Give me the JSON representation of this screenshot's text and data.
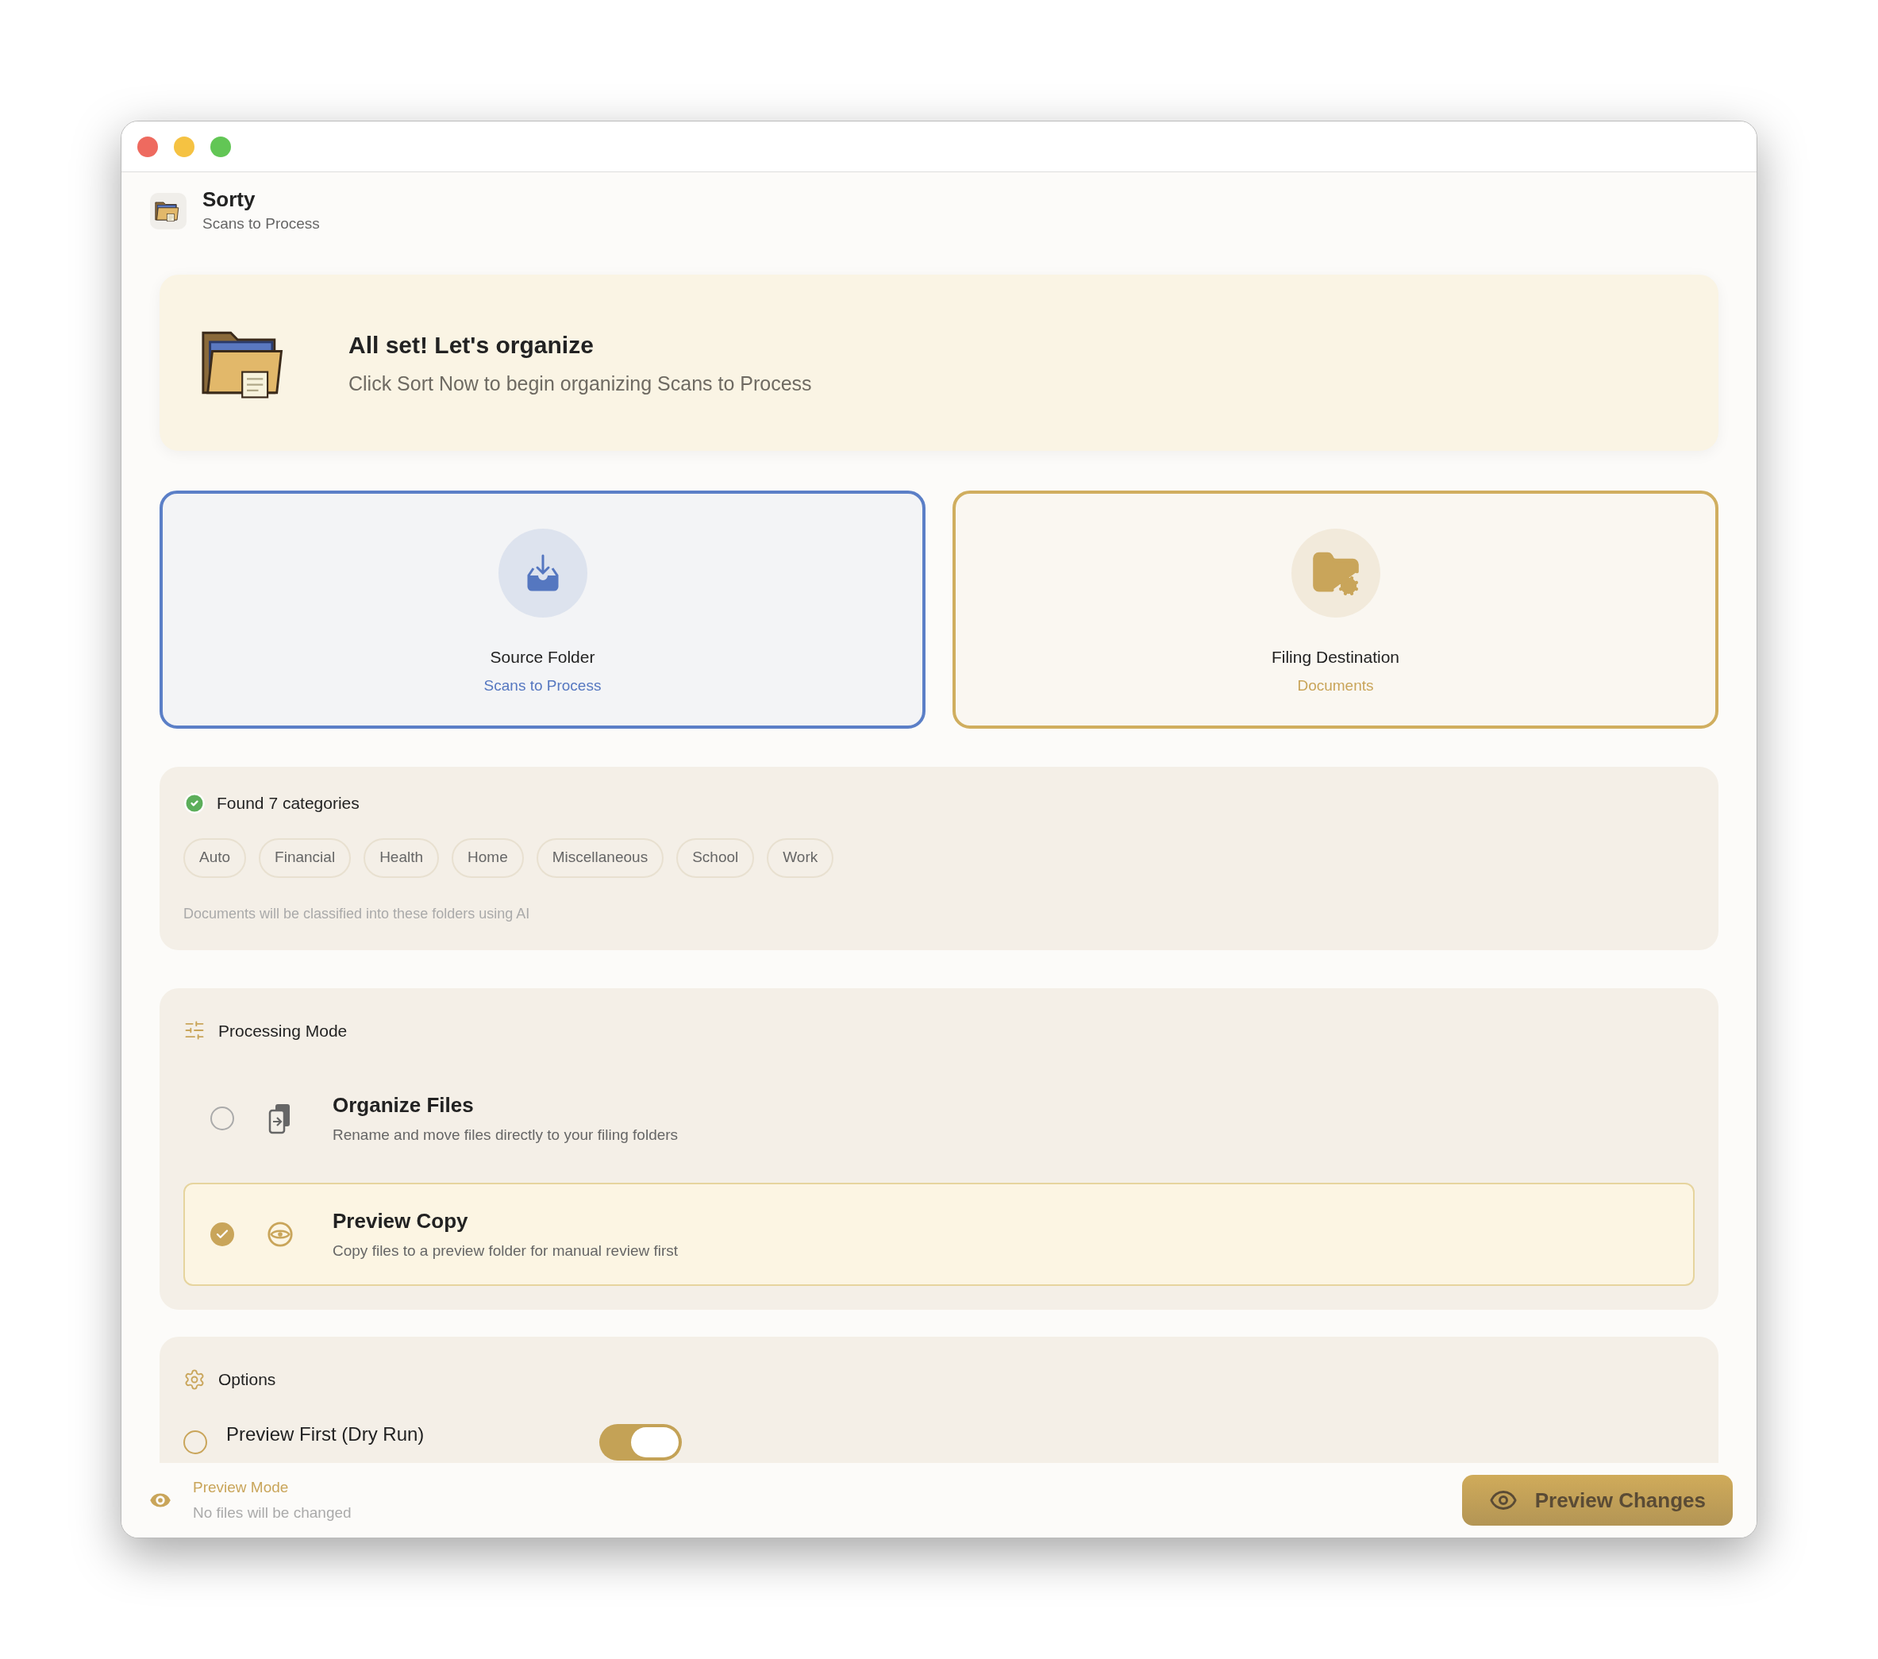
{
  "app": {
    "name": "Sorty",
    "subtitle": "Scans to Process"
  },
  "banner": {
    "title": "All set! Let's organize",
    "message": "Click Sort Now to begin organizing Scans to Process"
  },
  "folders": [
    {
      "kind": "source",
      "label": "Source Folder",
      "value": "Scans to Process"
    },
    {
      "kind": "destination",
      "label": "Filing Destination",
      "value": "Documents"
    }
  ],
  "categories": {
    "title": "Found 7 categories",
    "chips": [
      "Auto",
      "Financial",
      "Health",
      "Home",
      "Miscellaneous",
      "School",
      "Work"
    ],
    "note": "Documents will be classified into these folders using AI"
  },
  "processing_mode": {
    "title": "Processing Mode",
    "options": [
      {
        "kind": "organize",
        "title": "Organize Files",
        "description": "Rename and move files directly to your filing folders",
        "selected": false
      },
      {
        "kind": "preview",
        "title": "Preview Copy",
        "description": "Copy files to a preview folder for manual review first",
        "selected": true
      }
    ]
  },
  "options": {
    "title": "Options",
    "items": [
      {
        "label": "Preview First (Dry Run)",
        "on": true
      }
    ]
  },
  "footer": {
    "mode": "Preview Mode",
    "note": "No files will be changed",
    "button": "Preview Changes"
  }
}
